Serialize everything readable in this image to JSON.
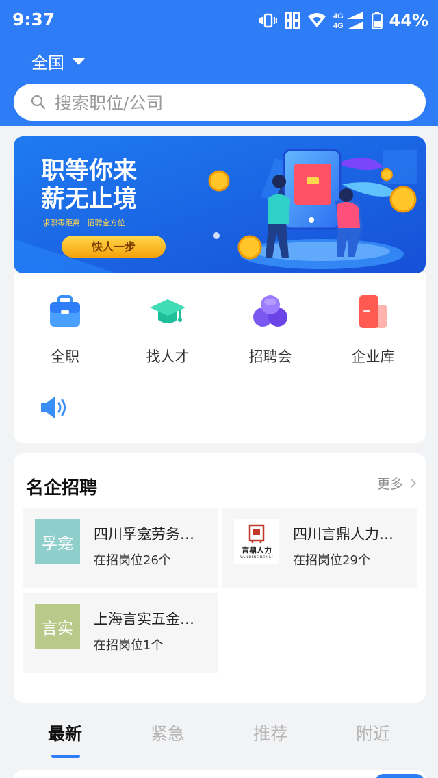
{
  "status_bar": {
    "time": "9:37",
    "battery": "44%",
    "network": "4G",
    "icons": [
      "vibrate-icon",
      "sim-icon",
      "wifi-icon",
      "signal-icon",
      "battery-icon"
    ]
  },
  "header": {
    "region": "全国",
    "search_placeholder": "搜索职位/公司",
    "accent_color": "#2f7df6"
  },
  "banner": {
    "headline_1": "职等你来",
    "headline_2": "薪无止境",
    "subtext": "求职零距离 · 招聘全方位",
    "button": "快人一步"
  },
  "quick_links": [
    {
      "label": "全职",
      "icon": "briefcase-icon"
    },
    {
      "label": "找人才",
      "icon": "graduation-cap-icon"
    },
    {
      "label": "招聘会",
      "icon": "circles-icon"
    },
    {
      "label": "企业库",
      "icon": "building-card-icon"
    }
  ],
  "announcement": {
    "icon": "speaker-icon"
  },
  "famous_companies": {
    "title": "名企招聘",
    "more": "更多",
    "items": [
      {
        "name": "四川孚龛劳务…",
        "count": "在招岗位26个",
        "logo_text": "孚龛",
        "logo_color": "#8ecfcb"
      },
      {
        "name": "四川言鼎人力…",
        "count": "在招岗位29个",
        "logo_text": "言鼎人力",
        "logo_sub": "YANDINGRENLI",
        "logo_color": "#c0392b"
      },
      {
        "name": "上海言实五金…",
        "count": "在招岗位1个",
        "logo_text": "言实",
        "logo_color": "#b9c98a"
      }
    ]
  },
  "tabs": [
    {
      "label": "最新",
      "active": true
    },
    {
      "label": "紧急",
      "active": false
    },
    {
      "label": "推荐",
      "active": false
    },
    {
      "label": "附近",
      "active": false
    }
  ]
}
